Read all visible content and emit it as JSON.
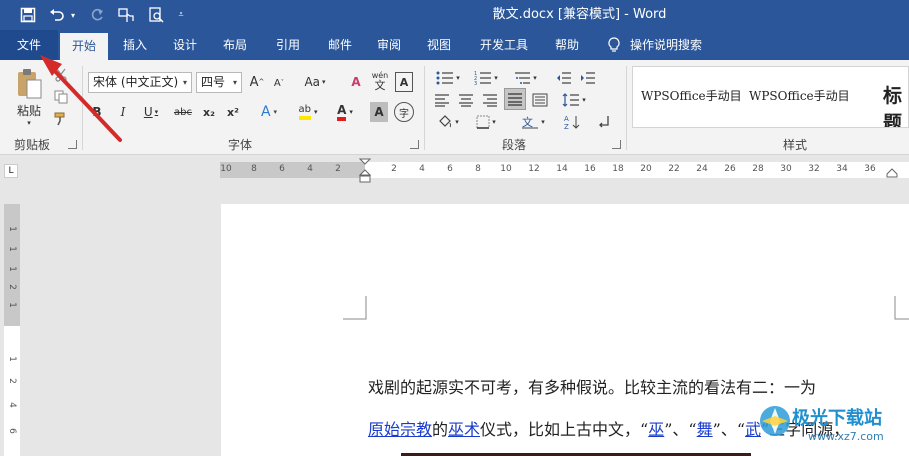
{
  "window": {
    "title": "散文.docx [兼容模式]  -  Word"
  },
  "quick_access": {
    "icons": [
      "save-icon",
      "undo-icon",
      "redo-icon",
      "touch-mode-icon",
      "print-preview-icon",
      "customize-icon"
    ]
  },
  "tabs": [
    "文件",
    "开始",
    "插入",
    "设计",
    "布局",
    "引用",
    "邮件",
    "审阅",
    "视图",
    "开发工具",
    "帮助"
  ],
  "tell_me": "操作说明搜索",
  "clipboard": {
    "paste_label": "粘贴",
    "group_label": "剪贴板"
  },
  "font": {
    "font_name": "宋体 (中文正文)",
    "font_size": "四号",
    "group_label": "字体",
    "btns": {
      "grow": "A",
      "shrink": "A",
      "case": "Aa",
      "clear": "A",
      "phonetic": "wén",
      "border_a": "A",
      "bold": "B",
      "italic": "I",
      "underline": "U",
      "strike": "abc",
      "sub": "x₂",
      "sup": "x²",
      "effects": "A",
      "highlight": "ab",
      "color": "A",
      "shade": "A",
      "enclose": "字"
    }
  },
  "paragraph": {
    "group_label": "段落"
  },
  "styles": {
    "group_label": "样式",
    "items": [
      "WPSOffice手动目",
      "WPSOffice手动目",
      "标题"
    ]
  },
  "ruler": {
    "marks": [
      "10",
      "8",
      "6",
      "4",
      "2",
      "",
      "2",
      "4",
      "6",
      "8",
      "10",
      "12",
      "14",
      "16",
      "18",
      "20",
      "22",
      "24",
      "26",
      "28",
      "30",
      "32",
      "34",
      "36"
    ],
    "tab_selector": "L"
  },
  "vruler": {
    "marks": [
      "1",
      "1",
      "1",
      "2",
      "1",
      "1",
      "2",
      "4",
      "6"
    ]
  },
  "document": {
    "line1": "戏剧的起源实不可考，有多种假说。比较主流的看法有二：一为",
    "line2_parts": [
      {
        "text": "原始宗教",
        "link": true
      },
      {
        "text": "的",
        "link": false
      },
      {
        "text": "巫术",
        "link": true
      },
      {
        "text": "仪式，比如上古中文，“",
        "link": false
      },
      {
        "text": "巫",
        "link": true
      },
      {
        "text": "”、“",
        "link": false
      },
      {
        "text": "舞",
        "link": true
      },
      {
        "text": "”、“",
        "link": false
      },
      {
        "text": "武",
        "link": true
      },
      {
        "text": "”三字同源，",
        "link": false
      }
    ]
  },
  "watermark": {
    "title": "极光下载站",
    "url": "www.xz7.com"
  },
  "colors": {
    "accent": "#2b579a",
    "annotation_arrow": "#d42a2a",
    "link": "#1a3ccc"
  }
}
